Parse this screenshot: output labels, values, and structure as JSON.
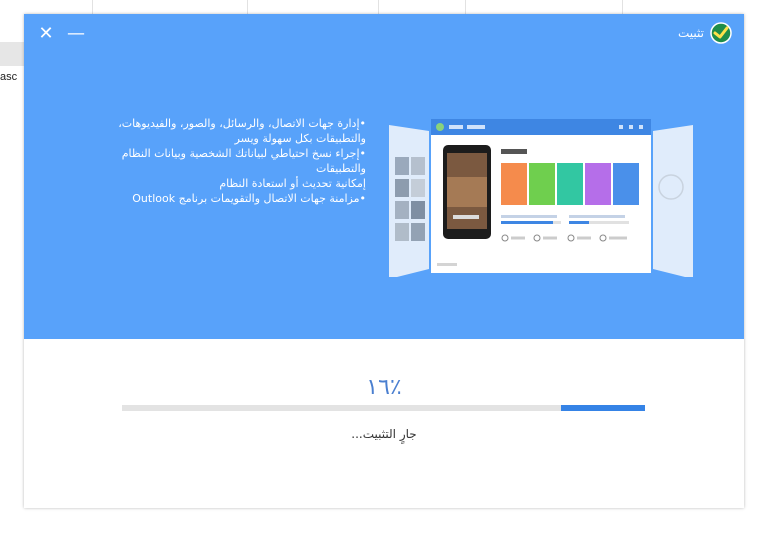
{
  "background": {
    "fragment_text": "asc"
  },
  "window": {
    "title": "تثبيت",
    "controls": {
      "close_icon": "close-icon",
      "minimize_icon": "minimize-icon",
      "close_glyph": "✕",
      "minimize_glyph": "—"
    },
    "features": [
      "•إدارة جهات الاتصال، والرسائل، والصور، والفيديوهات،",
      "والتطبيقات بكل سهولة ويسر",
      "•إجراء نسخ احتياطي لبياناتك الشخصية وبيانات النظام",
      "والتطبيقات",
      "إمكانية تحديث أو استعادة النظام",
      "•مزامنة جهات الاتصال والتقويمات برنامج Outlook"
    ]
  },
  "progress": {
    "percent_label": "١٦٪",
    "value": 0.16,
    "status": "جارٍ التثبيت..."
  },
  "colors": {
    "banner": "#58a2fa",
    "progress_fill": "#3583e6",
    "progress_track": "#e3e3e3",
    "percent_text": "#4a7fd0"
  }
}
